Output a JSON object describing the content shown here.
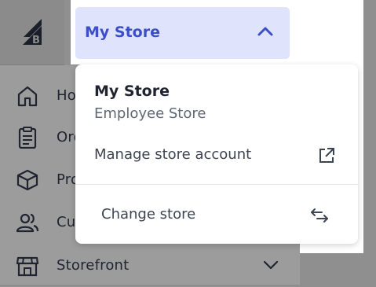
{
  "app": {
    "logo_icon": "bigcommerce-logo-icon",
    "accent": "#3b50c8"
  },
  "store_selector": {
    "label": "My Store",
    "state": "expanded",
    "chevron_icon": "chevron-up-icon"
  },
  "dropdown": {
    "current_store_name": "My Store",
    "current_store_type": "Employee Store",
    "manage_label": "Manage store account",
    "manage_icon": "external-link-icon",
    "change_label": "Change store",
    "change_icon": "swap-arrows-icon"
  },
  "sidebar": {
    "items": [
      {
        "label": "Home",
        "icon": "home-icon"
      },
      {
        "label": "Orders",
        "icon": "clipboard-icon"
      },
      {
        "label": "Products",
        "icon": "box-icon"
      },
      {
        "label": "Customers",
        "icon": "users-icon"
      },
      {
        "label": "Storefront",
        "icon": "storefront-icon",
        "chevron": "chevron-down-icon"
      }
    ]
  }
}
